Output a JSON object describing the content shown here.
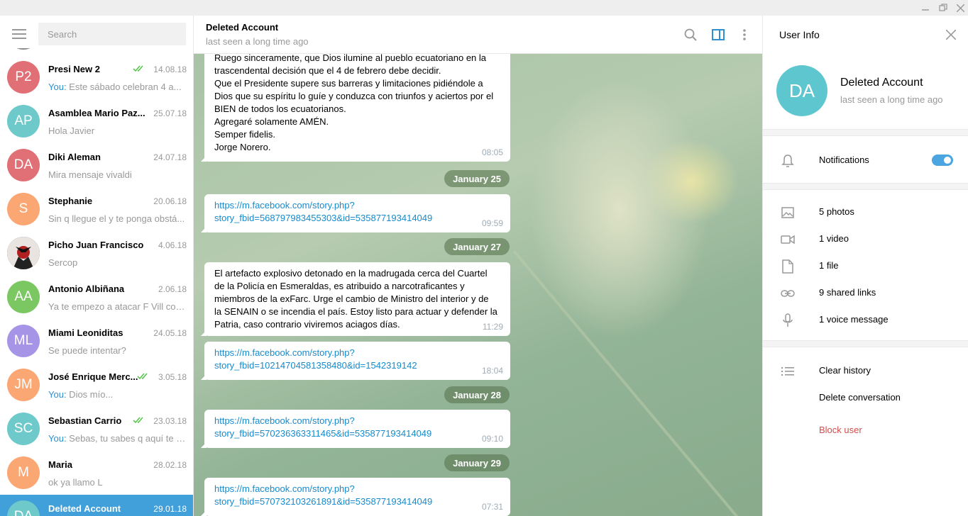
{
  "sidebar": {
    "search_placeholder": "Search",
    "chats": [
      {
        "initials": "P2",
        "color": "#e17076",
        "name": "Presi New 2",
        "date": "14.08.18",
        "you": "You:",
        "preview": " Este sábado celebran 4 a...",
        "read": true
      },
      {
        "initials": "AP",
        "color": "#6ec9cb",
        "name": "Asamblea Mario Paz...",
        "date": "25.07.18",
        "you": "",
        "preview": "Hola Javier",
        "read": false
      },
      {
        "initials": "DA",
        "color": "#e17076",
        "name": "Diki Aleman",
        "date": "24.07.18",
        "you": "",
        "preview": "Mira mensaje vivaldi",
        "read": false
      },
      {
        "initials": "S",
        "color": "#faa774",
        "name": "Stephanie",
        "date": "20.06.18",
        "you": "",
        "preview": "Sin q llegue el y te ponga obstá...",
        "read": false
      },
      {
        "initials": "",
        "color": "#3a2a2a",
        "name": "Picho Juan Francisco",
        "date": "4.06.18",
        "you": "",
        "preview": "Sercop",
        "read": false,
        "photo": true
      },
      {
        "initials": "AA",
        "color": "#7bc862",
        "name": "Antonio Albiñana",
        "date": "2.06.18",
        "you": "",
        "preview": "Ya te empezo a atacar F Vill con...",
        "read": false
      },
      {
        "initials": "ML",
        "color": "#a695e7",
        "name": "Miami Leoniditas",
        "date": "24.05.18",
        "you": "",
        "preview": "Se puede intentar?",
        "read": false
      },
      {
        "initials": "JM",
        "color": "#faa774",
        "name": "José Enrique Merc...",
        "date": "3.05.18",
        "you": "You:",
        "preview": " Dios mío...",
        "read": true
      },
      {
        "initials": "SC",
        "color": "#6ec9cb",
        "name": "Sebastian Carrio",
        "date": "23.03.18",
        "you": "You:",
        "preview": " Sebas, tu sabes q aquí te q...",
        "read": true
      },
      {
        "initials": "M",
        "color": "#faa774",
        "name": "Maria",
        "date": "28.02.18",
        "you": "",
        "preview": "ok ya llamo L",
        "read": false
      },
      {
        "initials": "DA",
        "color": "#6ec9cb",
        "name": "Deleted Account",
        "date": "29.01.18",
        "you": "",
        "preview": "",
        "read": false,
        "active": true
      }
    ]
  },
  "chat": {
    "name": "Deleted Account",
    "status": "last seen a long time ago",
    "messages": [
      {
        "lines": [
          "Ruego sinceramente, que Dios ilumine al pueblo ecuatoriano en la",
          "trascendental decisión que el 4 de febrero debe decidir.",
          "Que el Presidente supere sus barreras y limitaciones pidiéndole a",
          "Dios que su espíritu lo guíe y conduzca con triunfos y aciertos por el",
          "BIEN de todos los ecuatorianos.",
          "Agregaré  solamente AMÉN.",
          "Semper fidelis.",
          "Jorge Norero."
        ],
        "time": "08:05"
      },
      {
        "date": "January 25"
      },
      {
        "link": [
          "https://m.facebook.com/story.php?",
          "story_fbid=568797983455303&id=535877193414049"
        ],
        "time": "09:59"
      },
      {
        "date": "January 27"
      },
      {
        "lines": [
          "El artefacto explosivo detonado en la madrugada cerca del Cuartel",
          "de la Policía en Esmeraldas,  es atribuido a narcotraficantes y",
          "miembros de la exFarc. Urge el cambio de Ministro del interior y de",
          "la SENAIN o se incendia el país. Estoy listo para actuar y defender la",
          "Patria, caso contrario viviremos aciagos días."
        ],
        "time": "11:29"
      },
      {
        "link": [
          "https://m.facebook.com/story.php?",
          "story_fbid=10214704581358480&id=1542319142"
        ],
        "time": "18:04"
      },
      {
        "date": "January 28"
      },
      {
        "link": [
          "https://m.facebook.com/story.php?",
          "story_fbid=570236363311465&id=535877193414049"
        ],
        "time": "09:10"
      },
      {
        "date": "January 29"
      },
      {
        "link": [
          "https://m.facebook.com/story.php?",
          "story_fbid=570732103261891&id=535877193414049"
        ],
        "time": "07:31"
      }
    ]
  },
  "info": {
    "title": "User Info",
    "initials": "DA",
    "name": "Deleted Account",
    "status": "last seen a long time ago",
    "notifications_label": "Notifications",
    "notifications_on": true,
    "media": [
      {
        "icon": "photo-icon",
        "label": "5 photos"
      },
      {
        "icon": "video-icon",
        "label": "1 video"
      },
      {
        "icon": "file-icon",
        "label": "1 file"
      },
      {
        "icon": "link-icon",
        "label": "9 shared links"
      },
      {
        "icon": "microphone-icon",
        "label": "1 voice message"
      }
    ],
    "clear_history": "Clear history",
    "delete_conversation": "Delete conversation",
    "block_user": "Block user"
  }
}
